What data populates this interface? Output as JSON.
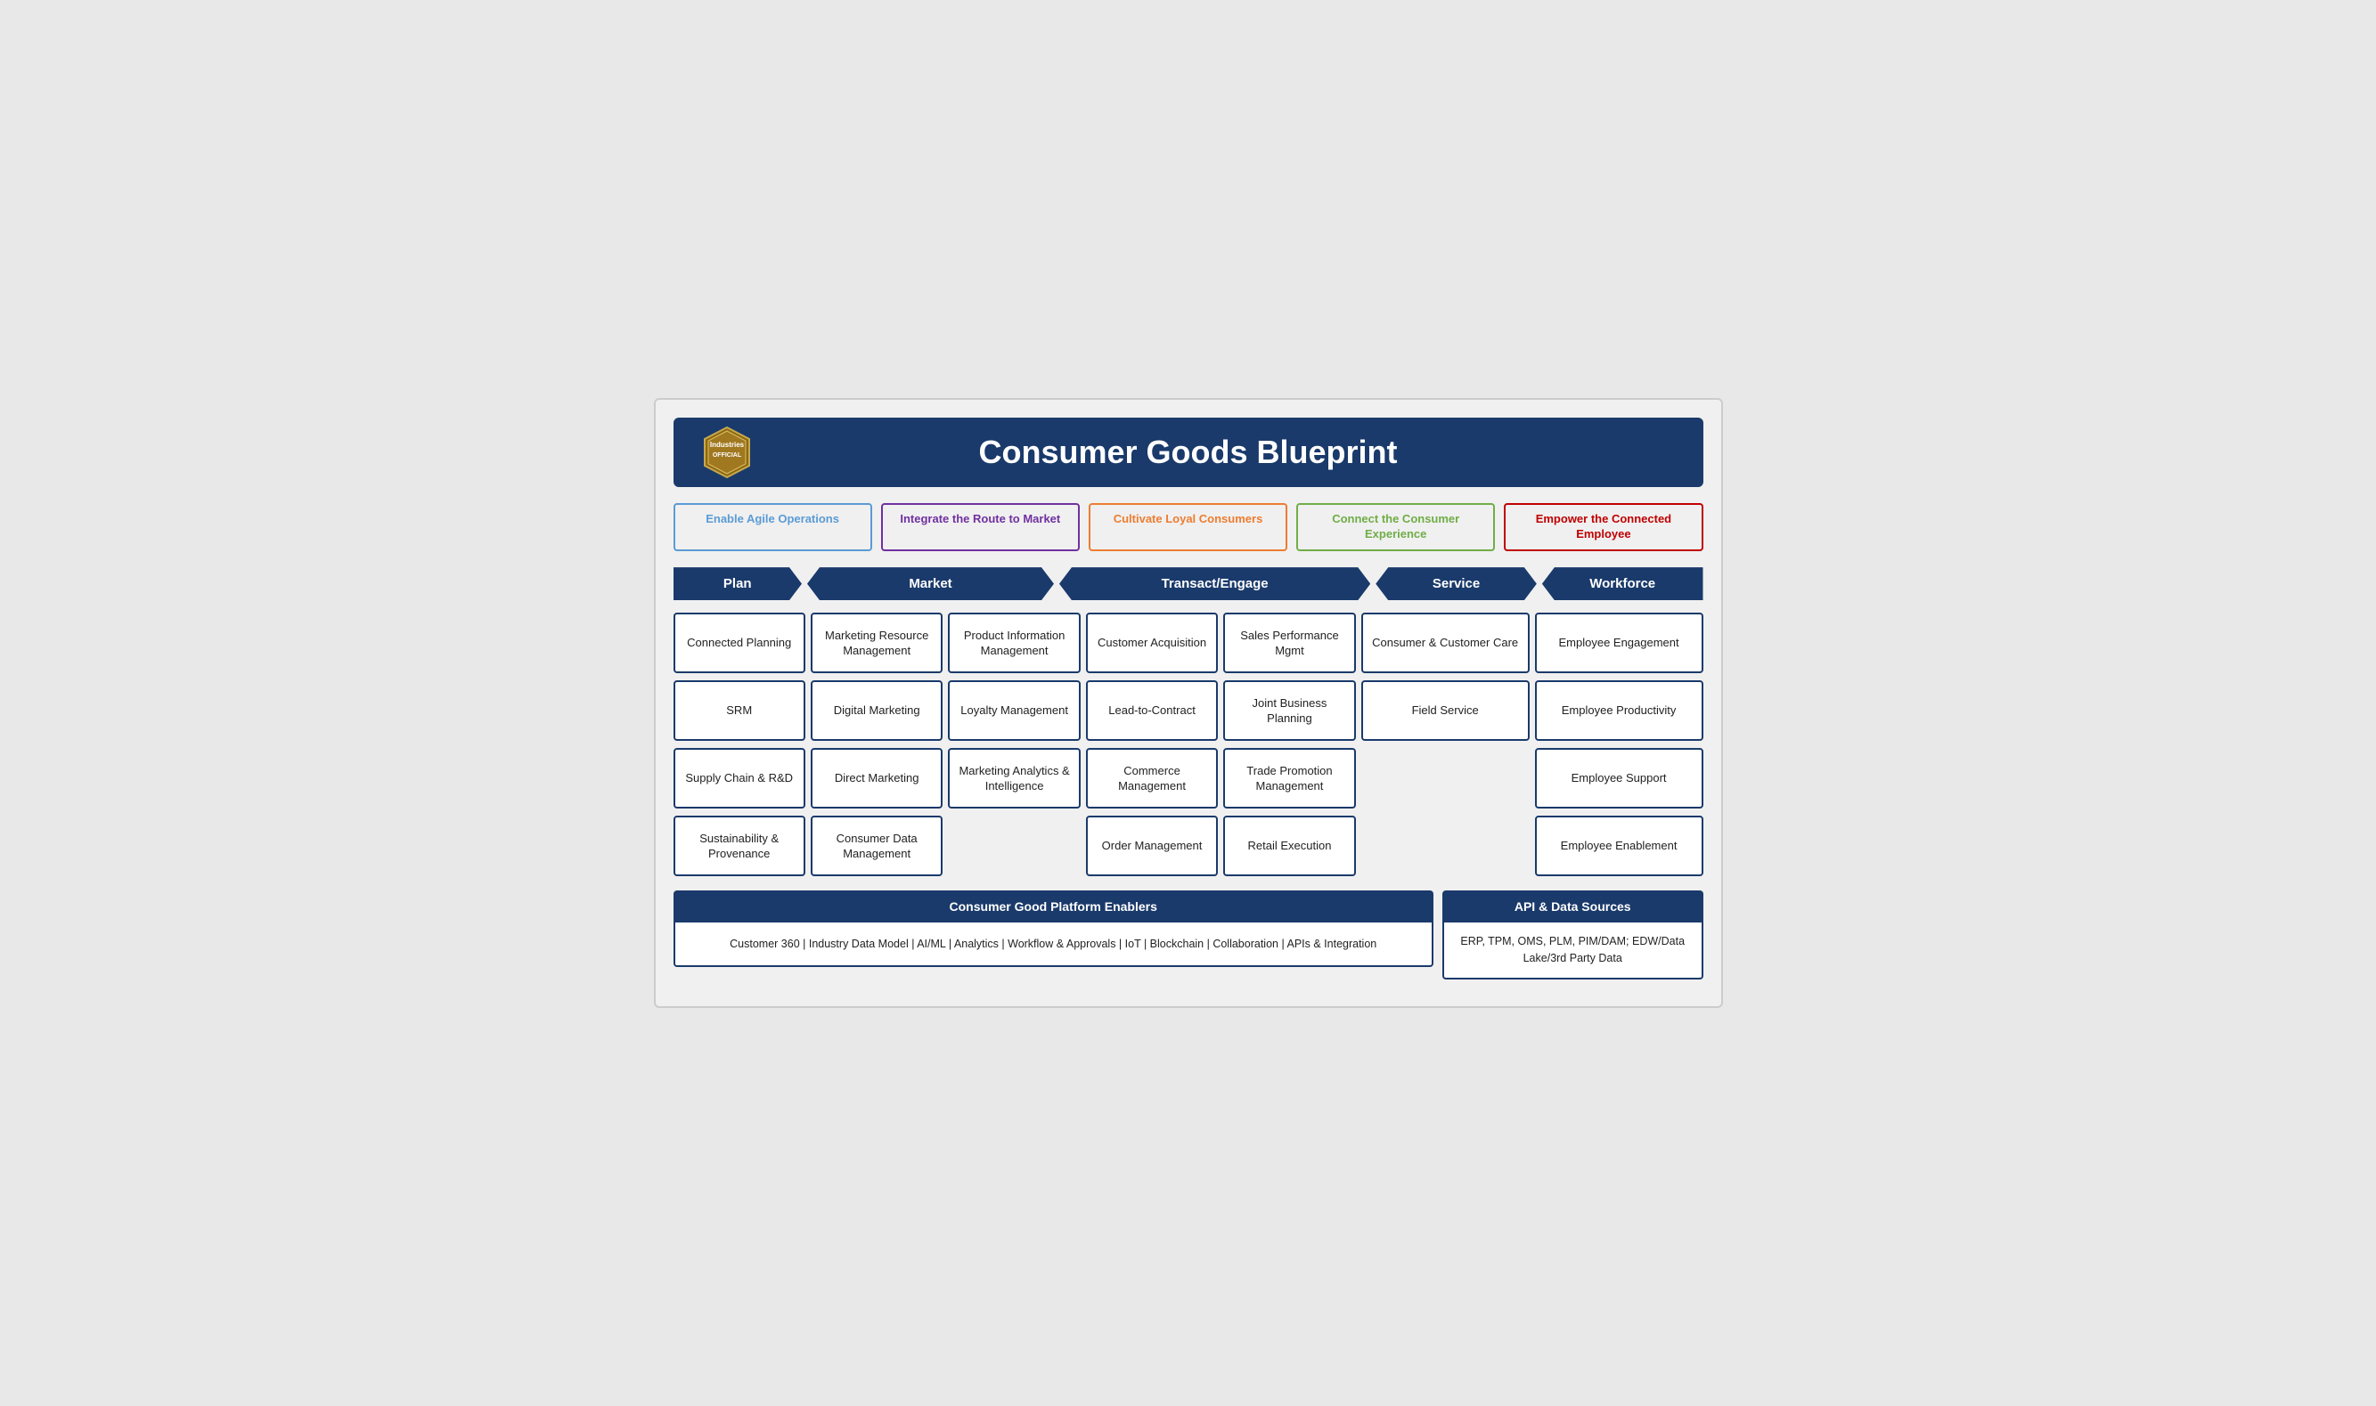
{
  "header": {
    "title": "Consumer Goods Blueprint",
    "badge_line1": "Industries",
    "badge_line2": "OFFICIAL"
  },
  "strategy_banners": [
    {
      "id": "s1",
      "label": "Enable Agile Operations",
      "class": "s1"
    },
    {
      "id": "s2",
      "label": "Integrate the Route to Market",
      "class": "s2"
    },
    {
      "id": "s3",
      "label": "Cultivate Loyal Consumers",
      "class": "s3"
    },
    {
      "id": "s4",
      "label": "Connect the Consumer Experience",
      "class": "s4"
    },
    {
      "id": "s5",
      "label": "Empower the Connected Employee",
      "class": "s5"
    }
  ],
  "phases": [
    {
      "label": "Plan",
      "class": "ph-plan first"
    },
    {
      "label": "Market",
      "class": "ph-market not-first"
    },
    {
      "label": "Transact/Engage",
      "class": "ph-transact not-first"
    },
    {
      "label": "Service",
      "class": "ph-service not-first"
    },
    {
      "label": "Workforce",
      "class": "ph-workforce last"
    }
  ],
  "columns": {
    "plan": [
      "Connected Planning",
      "SRM",
      "Supply Chain & R&D",
      "Sustainability & Provenance"
    ],
    "market1": [
      "Marketing Resource Management",
      "Digital Marketing",
      "Direct Marketing",
      "Consumer Data Management"
    ],
    "market2": [
      "Product Information Management",
      "Loyalty Management",
      "Marketing Analytics & Intelligence",
      ""
    ],
    "transact1": [
      "Customer Acquisition",
      "Lead-to-Contract",
      "Commerce Management",
      "Order Management"
    ],
    "transact2": [
      "Sales Performance Mgmt",
      "Joint Business Planning",
      "Trade Promotion Management",
      "Retail Execution"
    ],
    "service": [
      "Consumer & Customer Care",
      "Field Service",
      "",
      ""
    ],
    "workforce": [
      "Employee Engagement",
      "Employee Productivity",
      "Employee Support",
      "Employee Enablement"
    ]
  },
  "bottom": {
    "platform_header": "Consumer Good Platform Enablers",
    "platform_content": "Customer 360  |  Industry Data Model  |  AI/ML  |  Analytics  |  Workflow & Approvals  |  IoT  |  Blockchain  |  Collaboration  |  APIs & Integration",
    "api_header": "API & Data Sources",
    "api_content": "ERP, TPM, OMS, PLM, PIM/DAM; EDW/Data Lake/3rd Party Data"
  }
}
